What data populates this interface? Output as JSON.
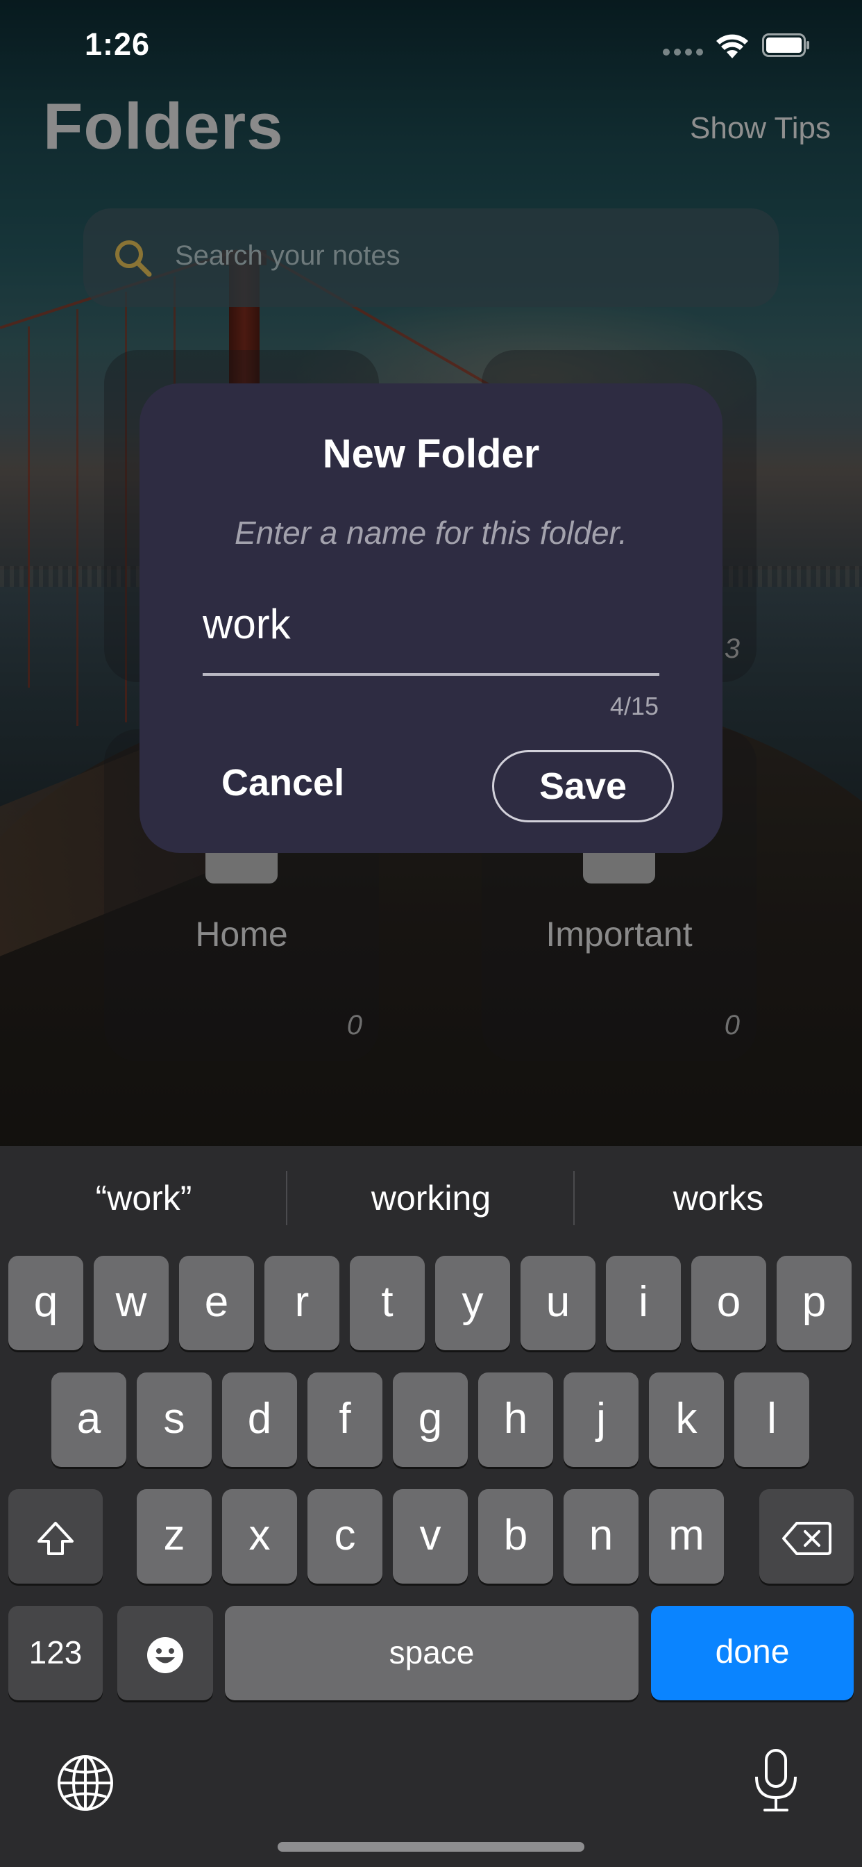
{
  "status_bar": {
    "time": "1:26"
  },
  "header": {
    "title": "Folders",
    "show_tips": "Show Tips"
  },
  "search": {
    "placeholder": "Search your notes"
  },
  "folders": [
    {
      "name": "",
      "count": ""
    },
    {
      "name": "",
      "count": "3"
    },
    {
      "name": "Home",
      "count": "0"
    },
    {
      "name": "Important",
      "count": "0"
    }
  ],
  "dialog": {
    "title": "New Folder",
    "subtitle": "Enter a name for this folder.",
    "input_value": "work",
    "char_count": "4/15",
    "cancel_label": "Cancel",
    "save_label": "Save"
  },
  "keyboard": {
    "suggestions": [
      "“work”",
      "working",
      "works"
    ],
    "row1": [
      "q",
      "w",
      "e",
      "r",
      "t",
      "y",
      "u",
      "i",
      "o",
      "p"
    ],
    "row2": [
      "a",
      "s",
      "d",
      "f",
      "g",
      "h",
      "j",
      "k",
      "l"
    ],
    "row3": [
      "z",
      "x",
      "c",
      "v",
      "b",
      "n",
      "m"
    ],
    "numbers_label": "123",
    "space_label": "space",
    "done_label": "done",
    "icons": [
      "shift-icon",
      "backspace-icon",
      "emoji-icon",
      "globe-icon",
      "microphone-icon"
    ]
  },
  "colors": {
    "accent": "#0a84ff",
    "dialog_bg": "#2e2c42",
    "keyboard_bg": "#2b2b2d",
    "key_bg": "#6c6c6e"
  }
}
